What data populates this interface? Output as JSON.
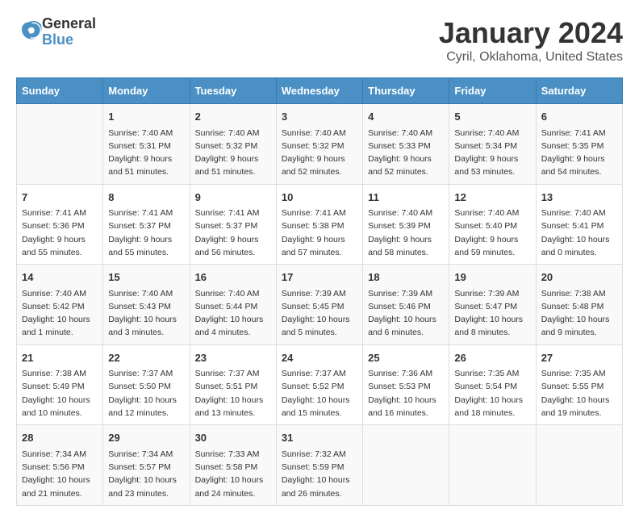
{
  "header": {
    "logo_line1": "General",
    "logo_line2": "Blue",
    "main_title": "January 2024",
    "subtitle": "Cyril, Oklahoma, United States"
  },
  "days": [
    "Sunday",
    "Monday",
    "Tuesday",
    "Wednesday",
    "Thursday",
    "Friday",
    "Saturday"
  ],
  "weeks": [
    [
      {
        "date": "",
        "content": ""
      },
      {
        "date": "1",
        "content": "Sunrise: 7:40 AM\nSunset: 5:31 PM\nDaylight: 9 hours\nand 51 minutes."
      },
      {
        "date": "2",
        "content": "Sunrise: 7:40 AM\nSunset: 5:32 PM\nDaylight: 9 hours\nand 51 minutes."
      },
      {
        "date": "3",
        "content": "Sunrise: 7:40 AM\nSunset: 5:32 PM\nDaylight: 9 hours\nand 52 minutes."
      },
      {
        "date": "4",
        "content": "Sunrise: 7:40 AM\nSunset: 5:33 PM\nDaylight: 9 hours\nand 52 minutes."
      },
      {
        "date": "5",
        "content": "Sunrise: 7:40 AM\nSunset: 5:34 PM\nDaylight: 9 hours\nand 53 minutes."
      },
      {
        "date": "6",
        "content": "Sunrise: 7:41 AM\nSunset: 5:35 PM\nDaylight: 9 hours\nand 54 minutes."
      }
    ],
    [
      {
        "date": "7",
        "content": "Sunrise: 7:41 AM\nSunset: 5:36 PM\nDaylight: 9 hours\nand 55 minutes."
      },
      {
        "date": "8",
        "content": "Sunrise: 7:41 AM\nSunset: 5:37 PM\nDaylight: 9 hours\nand 55 minutes."
      },
      {
        "date": "9",
        "content": "Sunrise: 7:41 AM\nSunset: 5:37 PM\nDaylight: 9 hours\nand 56 minutes."
      },
      {
        "date": "10",
        "content": "Sunrise: 7:41 AM\nSunset: 5:38 PM\nDaylight: 9 hours\nand 57 minutes."
      },
      {
        "date": "11",
        "content": "Sunrise: 7:40 AM\nSunset: 5:39 PM\nDaylight: 9 hours\nand 58 minutes."
      },
      {
        "date": "12",
        "content": "Sunrise: 7:40 AM\nSunset: 5:40 PM\nDaylight: 9 hours\nand 59 minutes."
      },
      {
        "date": "13",
        "content": "Sunrise: 7:40 AM\nSunset: 5:41 PM\nDaylight: 10 hours\nand 0 minutes."
      }
    ],
    [
      {
        "date": "14",
        "content": "Sunrise: 7:40 AM\nSunset: 5:42 PM\nDaylight: 10 hours\nand 1 minute."
      },
      {
        "date": "15",
        "content": "Sunrise: 7:40 AM\nSunset: 5:43 PM\nDaylight: 10 hours\nand 3 minutes."
      },
      {
        "date": "16",
        "content": "Sunrise: 7:40 AM\nSunset: 5:44 PM\nDaylight: 10 hours\nand 4 minutes."
      },
      {
        "date": "17",
        "content": "Sunrise: 7:39 AM\nSunset: 5:45 PM\nDaylight: 10 hours\nand 5 minutes."
      },
      {
        "date": "18",
        "content": "Sunrise: 7:39 AM\nSunset: 5:46 PM\nDaylight: 10 hours\nand 6 minutes."
      },
      {
        "date": "19",
        "content": "Sunrise: 7:39 AM\nSunset: 5:47 PM\nDaylight: 10 hours\nand 8 minutes."
      },
      {
        "date": "20",
        "content": "Sunrise: 7:38 AM\nSunset: 5:48 PM\nDaylight: 10 hours\nand 9 minutes."
      }
    ],
    [
      {
        "date": "21",
        "content": "Sunrise: 7:38 AM\nSunset: 5:49 PM\nDaylight: 10 hours\nand 10 minutes."
      },
      {
        "date": "22",
        "content": "Sunrise: 7:37 AM\nSunset: 5:50 PM\nDaylight: 10 hours\nand 12 minutes."
      },
      {
        "date": "23",
        "content": "Sunrise: 7:37 AM\nSunset: 5:51 PM\nDaylight: 10 hours\nand 13 minutes."
      },
      {
        "date": "24",
        "content": "Sunrise: 7:37 AM\nSunset: 5:52 PM\nDaylight: 10 hours\nand 15 minutes."
      },
      {
        "date": "25",
        "content": "Sunrise: 7:36 AM\nSunset: 5:53 PM\nDaylight: 10 hours\nand 16 minutes."
      },
      {
        "date": "26",
        "content": "Sunrise: 7:35 AM\nSunset: 5:54 PM\nDaylight: 10 hours\nand 18 minutes."
      },
      {
        "date": "27",
        "content": "Sunrise: 7:35 AM\nSunset: 5:55 PM\nDaylight: 10 hours\nand 19 minutes."
      }
    ],
    [
      {
        "date": "28",
        "content": "Sunrise: 7:34 AM\nSunset: 5:56 PM\nDaylight: 10 hours\nand 21 minutes."
      },
      {
        "date": "29",
        "content": "Sunrise: 7:34 AM\nSunset: 5:57 PM\nDaylight: 10 hours\nand 23 minutes."
      },
      {
        "date": "30",
        "content": "Sunrise: 7:33 AM\nSunset: 5:58 PM\nDaylight: 10 hours\nand 24 minutes."
      },
      {
        "date": "31",
        "content": "Sunrise: 7:32 AM\nSunset: 5:59 PM\nDaylight: 10 hours\nand 26 minutes."
      },
      {
        "date": "",
        "content": ""
      },
      {
        "date": "",
        "content": ""
      },
      {
        "date": "",
        "content": ""
      }
    ]
  ]
}
